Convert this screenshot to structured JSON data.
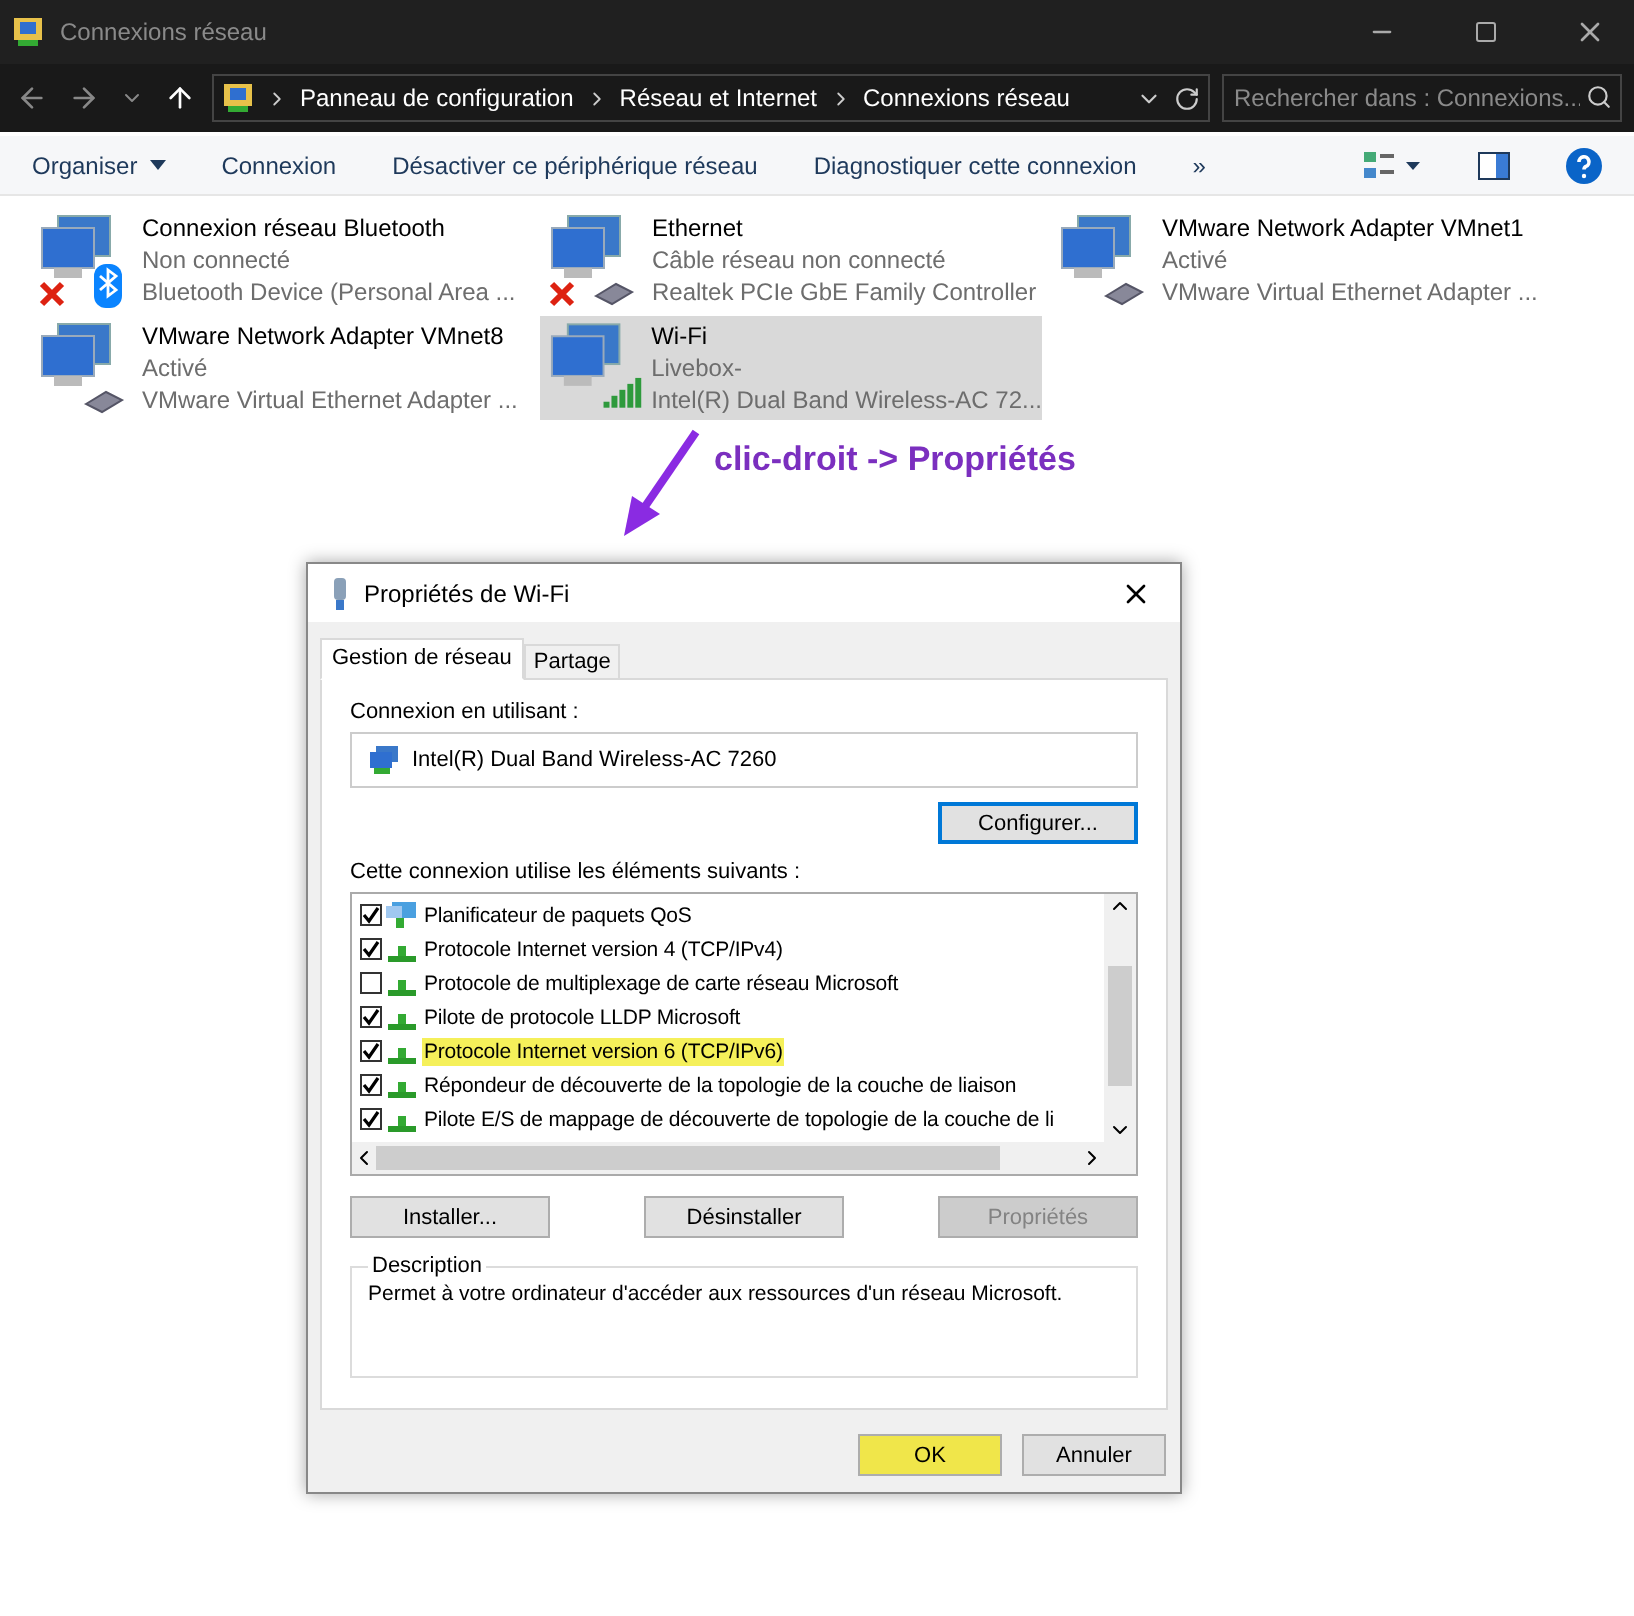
{
  "window": {
    "title": "Connexions réseau"
  },
  "address_bar": {
    "crumbs": [
      "Panneau de configuration",
      "Réseau et Internet",
      "Connexions réseau"
    ],
    "search_placeholder": "Rechercher dans : Connexions..."
  },
  "commands": [
    {
      "label": "Organiser",
      "dropdown": true
    },
    {
      "label": "Connexion",
      "dropdown": false
    },
    {
      "label": "Désactiver ce périphérique réseau",
      "dropdown": false
    },
    {
      "label": "Diagnostiquer cette connexion",
      "dropdown": false
    }
  ],
  "more_commands": "»",
  "adapters": [
    {
      "name": "Connexion réseau Bluetooth",
      "status": "Non connecté",
      "device": "Bluetooth Device (Personal Area ...",
      "kind": "bluetooth",
      "disconnected": true,
      "selected": false
    },
    {
      "name": "Ethernet",
      "status": "Câble réseau non connecté",
      "device": "Realtek PCIe GbE Family Controller",
      "kind": "ethernet",
      "disconnected": true,
      "selected": false
    },
    {
      "name": "VMware Network Adapter VMnet1",
      "status": "Activé",
      "device": "VMware Virtual Ethernet Adapter ...",
      "kind": "ethernet",
      "disconnected": false,
      "selected": false
    },
    {
      "name": "VMware Network Adapter VMnet8",
      "status": "Activé",
      "device": "VMware Virtual Ethernet Adapter ...",
      "kind": "ethernet",
      "disconnected": false,
      "selected": false
    },
    {
      "name": "Wi-Fi",
      "status": "Livebox-",
      "device": "Intel(R) Dual Band Wireless-AC 72...",
      "kind": "wifi",
      "disconnected": false,
      "selected": true
    }
  ],
  "annotation": "clic-droit -> Propriétés",
  "dialog": {
    "title": "Propriétés de Wi-Fi",
    "tabs": [
      {
        "label": "Gestion de réseau",
        "selected": true
      },
      {
        "label": "Partage",
        "selected": false
      }
    ],
    "connect_using_label": "Connexion en utilisant :",
    "adapter": "Intel(R) Dual Band Wireless-AC 7260",
    "configure_button": "Configurer...",
    "items_label": "Cette connexion utilise les éléments suivants :",
    "items": [
      {
        "label": "Planificateur de paquets QoS",
        "checked": true,
        "kind": "scheduler",
        "highlighted": false
      },
      {
        "label": "Protocole Internet version 4 (TCP/IPv4)",
        "checked": true,
        "kind": "protocol",
        "highlighted": false
      },
      {
        "label": "Protocole de multiplexage de carte réseau Microsoft",
        "checked": false,
        "kind": "protocol",
        "highlighted": false
      },
      {
        "label": "Pilote de protocole LLDP Microsoft",
        "checked": true,
        "kind": "protocol",
        "highlighted": false
      },
      {
        "label": "Protocole Internet version 6 (TCP/IPv6)",
        "checked": true,
        "kind": "protocol",
        "highlighted": true
      },
      {
        "label": "Répondeur de découverte de la topologie de la couche de liaison",
        "checked": true,
        "kind": "protocol",
        "highlighted": false
      },
      {
        "label": "Pilote E/S de mappage de découverte de topologie de la couche de li",
        "checked": true,
        "kind": "protocol",
        "highlighted": false
      }
    ],
    "item_buttons": [
      {
        "label": "Installer...",
        "disabled": false
      },
      {
        "label": "Désinstaller",
        "disabled": false
      },
      {
        "label": "Propriétés",
        "disabled": true
      }
    ],
    "description_title": "Description",
    "description": "Permet à votre ordinateur d'accéder aux ressources d'un réseau Microsoft.",
    "footer_buttons": [
      {
        "label": "OK",
        "highlighted": true
      },
      {
        "label": "Annuler",
        "highlighted": false
      }
    ]
  }
}
